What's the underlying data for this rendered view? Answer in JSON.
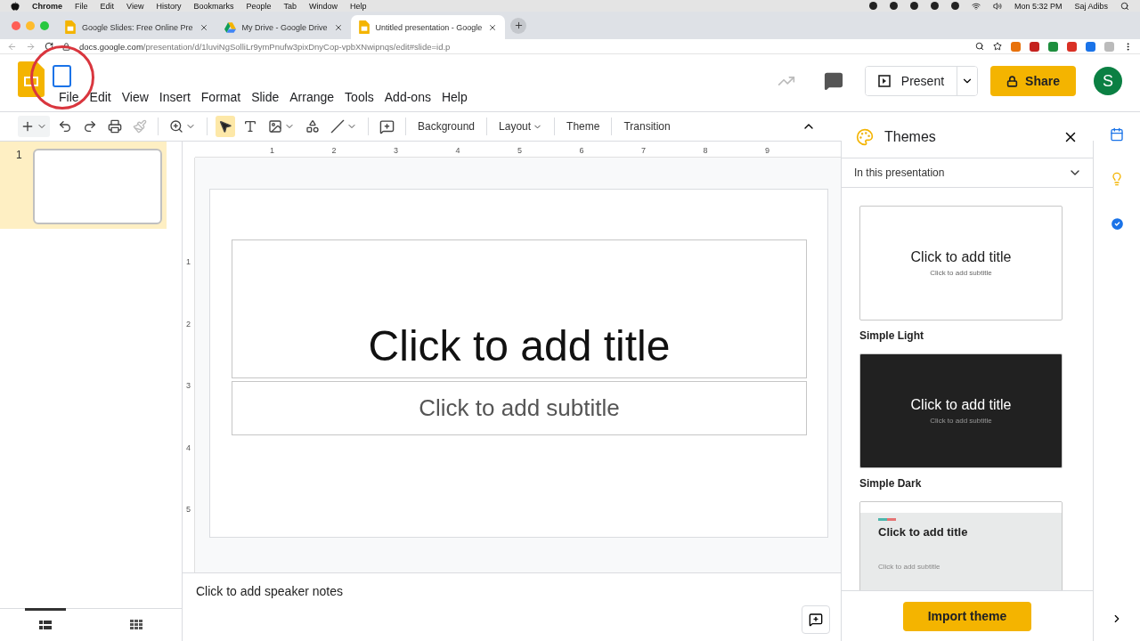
{
  "mac_menu_bar": {
    "app": "Chrome",
    "items": [
      "File",
      "Edit",
      "View",
      "History",
      "Bookmarks",
      "People",
      "Tab",
      "Window",
      "Help"
    ],
    "clock": "Mon 5:32 PM",
    "user": "Saj Adibs"
  },
  "browser": {
    "tabs": [
      {
        "title": "Google Slides: Free Online Pre",
        "kind": "slides",
        "selected": false
      },
      {
        "title": "My Drive - Google Drive",
        "kind": "drive",
        "selected": false
      },
      {
        "title": "Untitled presentation - Google",
        "kind": "slides",
        "selected": true
      }
    ],
    "url_host": "docs.google.com",
    "url_path": "/presentation/d/1luviNgSolliLr9ymPnufw3pixDnyCop-vpbXNwipnqs/edit#slide=id.p"
  },
  "menu": [
    "File",
    "Edit",
    "View",
    "Insert",
    "Format",
    "Slide",
    "Arrange",
    "Tools",
    "Add-ons",
    "Help"
  ],
  "header": {
    "present": "Present",
    "share": "Share",
    "avatar": "S"
  },
  "toolbar": {
    "select_tool_selected": true,
    "buttons": [
      {
        "label": "Background",
        "dropdown": false
      },
      {
        "label": "Layout",
        "dropdown": true
      },
      {
        "label": "Theme",
        "dropdown": false
      },
      {
        "label": "Transition",
        "dropdown": false
      }
    ]
  },
  "ruler": {
    "horizontal": [
      "1",
      "2",
      "3",
      "4",
      "5",
      "6",
      "7",
      "8",
      "9"
    ],
    "vertical": [
      "1",
      "2",
      "3",
      "4",
      "5"
    ]
  },
  "filmstrip": {
    "slides": [
      {
        "number": "1",
        "selected": true
      }
    ],
    "views": [
      {
        "kind": "list",
        "selected": true
      },
      {
        "kind": "grid",
        "selected": false
      }
    ]
  },
  "slide": {
    "title": "Click to add title",
    "subtitle": "Click to add subtitle"
  },
  "speaker_notes": {
    "placeholder": "Click to add speaker notes"
  },
  "themes_panel": {
    "title": "Themes",
    "section": "In this presentation",
    "themes": [
      {
        "kind": "light",
        "name": "Simple Light",
        "title": "Click to add title",
        "subtitle": "Click to add subtitle"
      },
      {
        "kind": "dark",
        "name": "Simple Dark",
        "title": "Click to add title",
        "subtitle": "Click to add subtitle"
      },
      {
        "kind": "streamline",
        "title": "Click to add title",
        "subtitle": "Click to add subtitle"
      }
    ],
    "import_button": "Import theme"
  }
}
